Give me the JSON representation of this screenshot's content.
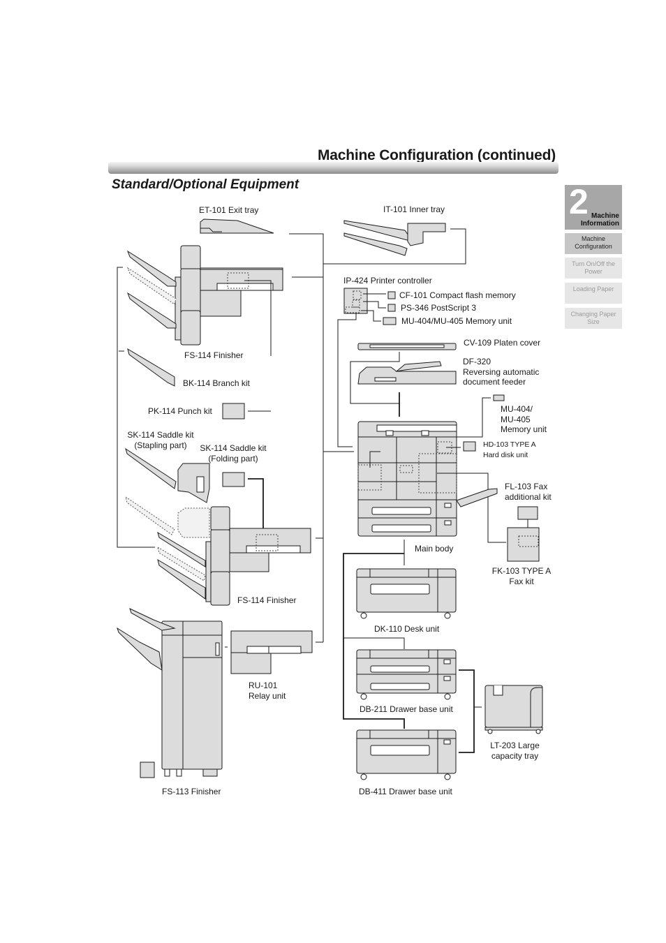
{
  "header": {
    "title": "Machine Configuration (continued)",
    "section_title": "Standard/Optional Equipment"
  },
  "sidebar": {
    "chapter_number": "2",
    "chapter_label": "Machine Information",
    "items": [
      {
        "label": "Machine Configuration",
        "state": "active"
      },
      {
        "label": "Turn On/Off the Power",
        "state": "inactive"
      },
      {
        "label": "Loading Paper",
        "state": "inactive"
      },
      {
        "label": "Changing Paper Size",
        "state": "inactive"
      }
    ]
  },
  "diagram": {
    "labels": {
      "et101": "ET-101 Exit tray",
      "it101": "IT-101 Inner tray",
      "ip424": "IP-424 Printer controller",
      "cf101": "CF-101 Compact flash memory",
      "ps346": "PS-346 PostScript 3",
      "mu404_ctrl": "MU-404/MU-405 Memory unit",
      "cv109": "CV-109 Platen cover",
      "df320": "DF-320\nReversing automatic\ndocument feeder",
      "mu404_body": "MU-404/\nMU-405\nMemory unit",
      "hd103": "HD-103 TYPE A\nHard disk unit",
      "fl103": "FL-103 Fax\nadditional kit",
      "fk103": "FK-103 TYPE A\nFax kit",
      "main_body": "Main body",
      "fs114_top": "FS-114 Finisher",
      "bk114": "BK-114 Branch kit",
      "pk114": "PK-114 Punch kit",
      "sk114_stapling": "SK-114 Saddle kit\n(Stapling part)",
      "sk114_folding": "SK-114 Saddle kit\n(Folding part)",
      "fs114_bottom": "FS-114 Finisher",
      "fs113": "FS-113 Finisher",
      "ru101": "RU-101\nRelay unit",
      "dk110": "DK-110 Desk unit",
      "db211": "DB-211 Drawer base unit",
      "db411": "DB-411 Drawer base unit",
      "lt203": "LT-203 Large\ncapacity tray"
    },
    "colors": {
      "fill": "#dcdcdc",
      "stroke": "#1a1a1a",
      "dashed": "#555555"
    }
  }
}
